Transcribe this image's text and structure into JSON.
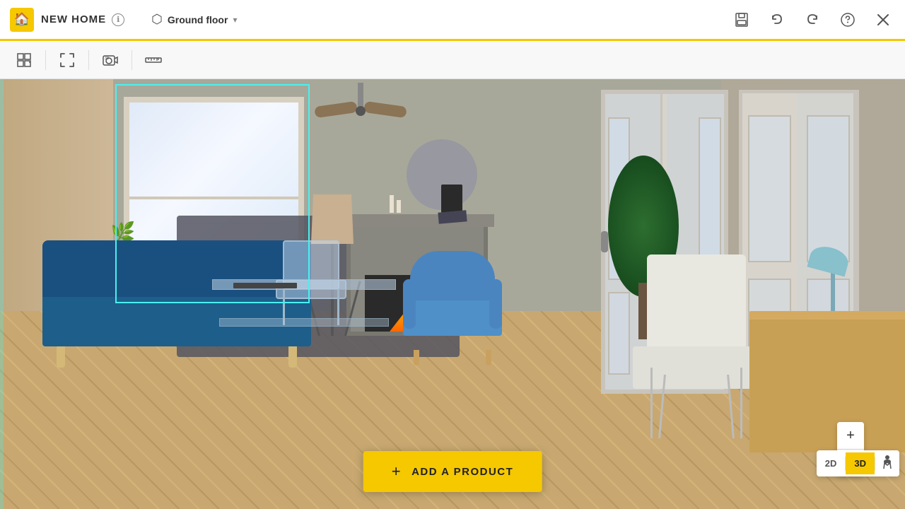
{
  "app": {
    "title": "NEW HOME",
    "floor_label": "Ground floor",
    "info_icon": "ℹ",
    "floor_icon": "⬡"
  },
  "toolbar": {
    "tools": [
      {
        "name": "grid-tool",
        "icon": "⊞",
        "label": "Grid"
      },
      {
        "name": "fullscreen-tool",
        "icon": "⛶",
        "label": "Fullscreen"
      },
      {
        "name": "camera-tool",
        "icon": "📷",
        "label": "Camera 3D"
      },
      {
        "name": "measure-tool",
        "icon": "📏",
        "label": "Measure"
      }
    ]
  },
  "topbar_right": {
    "save_icon": "💾",
    "undo_icon": "↩",
    "redo_icon": "↪",
    "help_icon": "?"
  },
  "add_product": {
    "label": "ADD A PRODUCT",
    "plus": "+"
  },
  "view_modes": {
    "2d": "2D",
    "3d": "3D",
    "active": "3D"
  },
  "zoom": {
    "plus": "+",
    "minus": "−"
  },
  "scene": {
    "description": "Living room 3D view with sofa, armchair, fireplace, plant, and french doors"
  }
}
